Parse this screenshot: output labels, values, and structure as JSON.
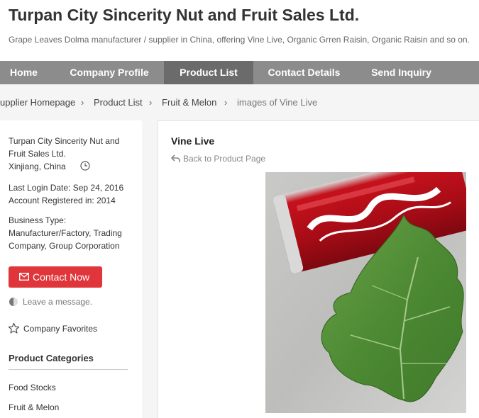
{
  "header": {
    "company_title": "Turpan City Sincerity Nut and Fruit Sales Ltd.",
    "tagline": "Grape Leaves Dolma manufacturer / supplier in China, offering Vine Live, Organic Grren Raisin, Organic Raisin and so on."
  },
  "nav": {
    "items": [
      {
        "label": "Home"
      },
      {
        "label": "Company Profile"
      },
      {
        "label": "Product List",
        "active": true
      },
      {
        "label": "Contact Details"
      },
      {
        "label": "Send Inquiry"
      }
    ]
  },
  "breadcrumb": {
    "items": [
      "upplier Homepage",
      "Product List",
      "Fruit & Melon",
      "images of Vine Live"
    ]
  },
  "sidebar": {
    "company_line1": "Turpan City Sincerity Nut and",
    "company_line2": "Fruit Sales Ltd.",
    "location": "Xinjiang, China",
    "last_login": "Last Login Date: Sep 24, 2016",
    "registered": "Account Registered in: 2014",
    "business_type_label": "Business Type:",
    "business_type_line1": "Manufacturer/Factory, Trading",
    "business_type_line2": "Company, Group Corporation",
    "contact_button": "Contact Now",
    "leave_message": "Leave a message.",
    "favorites": "Company Favorites",
    "categories_title": "Product Categories",
    "categories": [
      "Food Stocks",
      "Fruit & Melon"
    ]
  },
  "main": {
    "product_name": "Vine Live",
    "back_link": "Back to Product Page",
    "photo_icon": "product-photo"
  },
  "colors": {
    "nav_bg": "#8c8c8c",
    "nav_active": "#6b6b6b",
    "contact_red": "#e0353a",
    "page_bg": "#f5f5f5"
  }
}
